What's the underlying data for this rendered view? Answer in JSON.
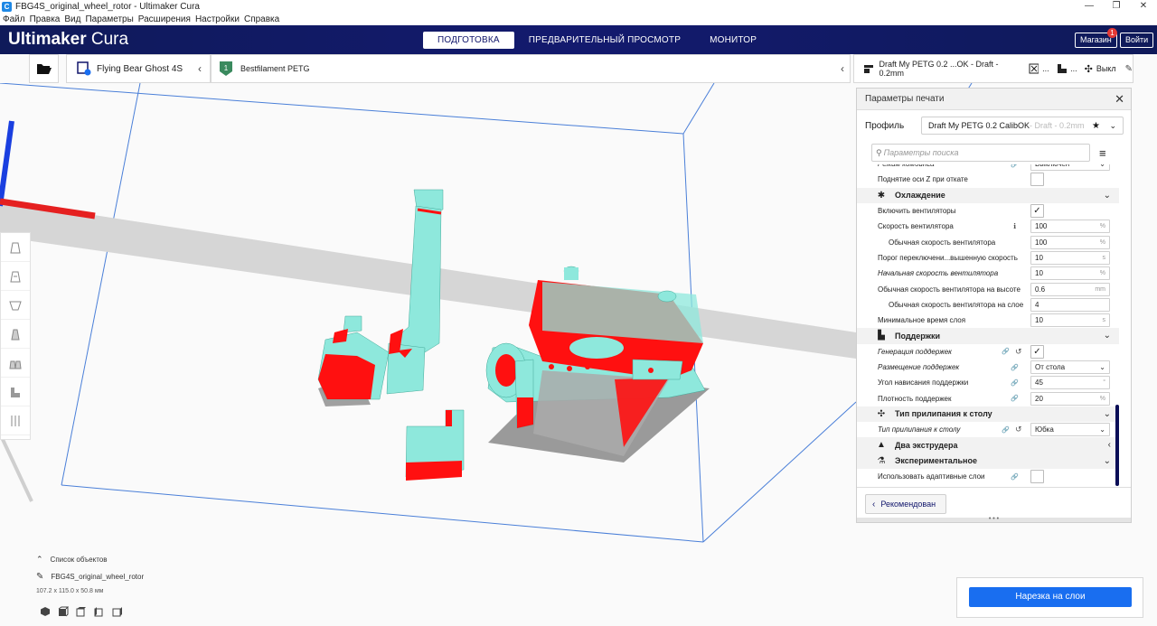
{
  "window": {
    "title": "FBG4S_original_wheel_rotor - Ultimaker Cura",
    "controls": [
      "—",
      "❐",
      "✕"
    ]
  },
  "menu": [
    "Файл",
    "Правка",
    "Вид",
    "Параметры",
    "Расширения",
    "Настройки",
    "Справка"
  ],
  "header": {
    "brand_bold": "Ultimaker",
    "brand_light": " Cura",
    "tabs": [
      {
        "label": "ПОДГОТОВКА",
        "active": true
      },
      {
        "label": "ПРЕДВАРИТЕЛЬНЫЙ ПРОСМОТР",
        "active": false
      },
      {
        "label": "МОНИТОР",
        "active": false
      }
    ],
    "store_label": "Магазин",
    "store_badge": "1",
    "login_label": "Войти"
  },
  "toolbar": {
    "machine_name": "Flying Bear Ghost 4S",
    "material_name": "Bestfilament PETG",
    "profile_summary": "Draft My PETG 0.2 ...OK - Draft - 0.2mm",
    "support_label": "...",
    "adhesion_label": "Выкл"
  },
  "panel": {
    "title": "Параметры печати",
    "profile_label": "Профиль",
    "profile_value": "Draft My PETG 0.2 CalibOK",
    "profile_suffix": " - Draft - 0.2mm",
    "search_placeholder": "Параметры поиска",
    "recommend_label": "Рекомендован",
    "rows": [
      {
        "type": "setting",
        "label": "Режим комбинга",
        "italic": true,
        "kind": "dropdown",
        "value": "Выключен",
        "link": true
      },
      {
        "type": "setting",
        "label": "Поднятие оси Z при откате",
        "kind": "check",
        "checked": false
      },
      {
        "type": "category",
        "label": "Охлаждение",
        "icon": "fan-icon",
        "glyph": "✱"
      },
      {
        "type": "setting",
        "label": "Включить вентиляторы",
        "kind": "check",
        "checked": true
      },
      {
        "type": "setting",
        "label": "Скорость вентилятора",
        "kind": "value",
        "value": "100",
        "unit": "%",
        "info": true
      },
      {
        "type": "setting",
        "label": "Обычная скорость вентилятора",
        "indent": true,
        "kind": "value",
        "value": "100",
        "unit": "%"
      },
      {
        "type": "setting",
        "label": "Порог переключени...вышенную скорость",
        "kind": "value",
        "value": "10",
        "unit": "s"
      },
      {
        "type": "setting",
        "label": "Начальная скорость вентилятора",
        "italic": true,
        "kind": "value",
        "value": "10",
        "unit": "%"
      },
      {
        "type": "setting",
        "label": "Обычная скорость вентилятора на высоте",
        "kind": "value",
        "value": "0.6",
        "unit": "mm"
      },
      {
        "type": "setting",
        "label": "Обычная скорость вентилятора на слое",
        "indent": true,
        "kind": "value",
        "value": "4",
        "unit": ""
      },
      {
        "type": "setting",
        "label": "Минимальное время слоя",
        "kind": "value",
        "value": "10",
        "unit": "s"
      },
      {
        "type": "category",
        "label": "Поддержки",
        "icon": "support-icon",
        "glyph": "▙"
      },
      {
        "type": "setting",
        "label": "Генерация поддержек",
        "italic": true,
        "kind": "check",
        "checked": true,
        "link": true,
        "reset": true
      },
      {
        "type": "setting",
        "label": "Размещение поддержек",
        "italic": true,
        "kind": "dropdown",
        "value": "От стола",
        "link": true
      },
      {
        "type": "setting",
        "label": "Угол нависания поддержки",
        "kind": "value",
        "value": "45",
        "unit": "°",
        "link": true
      },
      {
        "type": "setting",
        "label": "Плотность поддержек",
        "kind": "value",
        "value": "20",
        "unit": "%",
        "link": true
      },
      {
        "type": "category",
        "label": "Тип прилипания к столу",
        "icon": "adhesion-icon",
        "glyph": "✣"
      },
      {
        "type": "setting",
        "label": "Тип прилипания к столу",
        "italic": true,
        "kind": "dropdown",
        "value": "Юбка",
        "link": true,
        "reset": true
      },
      {
        "type": "category",
        "label": "Два экструдера",
        "icon": "dual-extruder-icon",
        "glyph": "▲",
        "collapsed": true
      },
      {
        "type": "category",
        "label": "Экспериментальное",
        "icon": "experimental-icon",
        "glyph": "⚗"
      },
      {
        "type": "setting",
        "label": "Использовать адаптивные слои",
        "kind": "check",
        "checked": false,
        "link": true
      }
    ]
  },
  "objects": {
    "list_label": "Список объектов",
    "object_name": "FBG4S_original_wheel_rotor",
    "dimensions": "107.2 x 115.0 x 50.8 мм"
  },
  "slice_label": "Нарезка на слои",
  "colors": {
    "header_bg": "#10156b",
    "accent_blue": "#196ef0",
    "model_cyan": "#8ee8dc",
    "overhang_red": "#ff1010"
  }
}
